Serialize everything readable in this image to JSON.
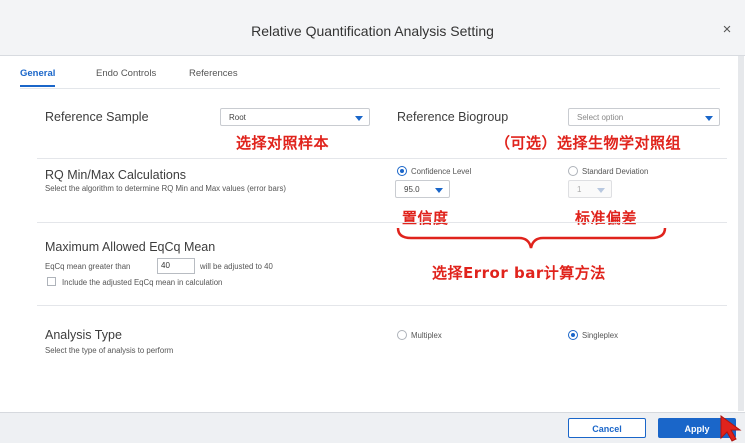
{
  "dialog": {
    "title": "Relative Quantification Analysis Setting",
    "close_icon": "close-icon",
    "close_glyph": "×"
  },
  "tabs": [
    {
      "label": "General",
      "active": true
    },
    {
      "label": "Endo Controls",
      "active": false
    },
    {
      "label": "References",
      "active": false
    }
  ],
  "reference": {
    "sample_label": "Reference Sample",
    "sample_value": "Root",
    "biogroup_label": "Reference Biogroup",
    "biogroup_placeholder": "Select option"
  },
  "rq": {
    "title": "RQ Min/Max Calculations",
    "description": "Select the algorithm to determine RQ Min and Max values (error bars)",
    "confidence_label": "Confidence Level",
    "confidence_selected": true,
    "confidence_value": "95.0",
    "stddev_label": "Standard Deviation",
    "stddev_selected": false,
    "stddev_value": "1"
  },
  "eqcq": {
    "title": "Maximum Allowed EqCq Mean",
    "prefix": "EqCq mean greater than",
    "value": "40",
    "suffix": "will be adjusted to 40",
    "checkbox_label": "Include the adjusted EqCq mean in calculation",
    "checkbox_checked": false
  },
  "analysis": {
    "title": "Analysis Type",
    "description": "Select the type of analysis to perform",
    "multiplex_label": "Multiplex",
    "multiplex_selected": false,
    "singleplex_label": "Singleplex",
    "singleplex_selected": true
  },
  "annotations": {
    "reference_sample": "选择对照样本",
    "biogroup": "（可选）选择生物学对照组",
    "confidence": "置信度",
    "stddev": "标准偏差",
    "errorbar": "选择Error bar计算方法"
  },
  "footer": {
    "cancel_label": "Cancel",
    "apply_label": "Apply"
  },
  "colors": {
    "accent": "#1a66c9",
    "annotation": "#e0231c"
  }
}
